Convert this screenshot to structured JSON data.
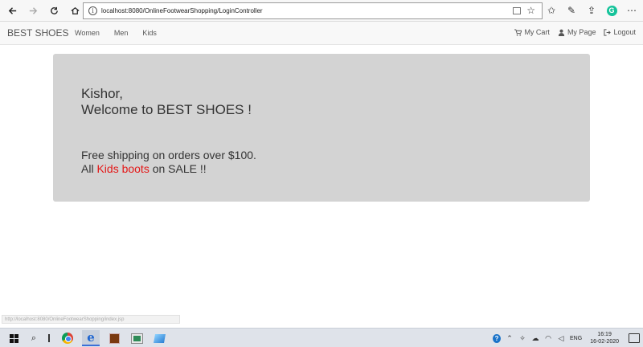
{
  "browser": {
    "url": "localhost:8080/OnlineFootwearShopping/LoginController"
  },
  "navbar": {
    "brand": "BEST SHOES",
    "links": [
      "Women",
      "Men",
      "Kids"
    ],
    "right": {
      "cart": "My Cart",
      "mypage": "My Page",
      "logout": "Logout"
    }
  },
  "welcome": {
    "name_line": "Kishor,",
    "message": "Welcome to BEST SHOES !",
    "promo_line1": "Free shipping on orders over $100.",
    "promo_prefix": "All ",
    "promo_highlight": "Kids boots",
    "promo_suffix": " on SALE !!"
  },
  "status_hint": "http://localhost:8080/OnlineFootwearShopping/index.jsp",
  "taskbar": {
    "language": "ENG",
    "time": "16:19",
    "date": "16-02-2020"
  },
  "colors": {
    "jumbotron_bg": "#d3d3d3",
    "highlight": "#e41818"
  }
}
